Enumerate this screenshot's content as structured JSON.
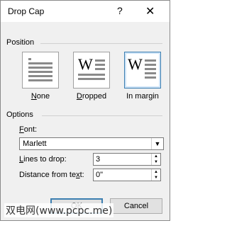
{
  "dialog": {
    "title": "Drop Cap",
    "help_glyph": "?",
    "close_glyph": "✕"
  },
  "position": {
    "section_label": "Position",
    "options": [
      {
        "label": "None",
        "access_key": "N",
        "rest": "one"
      },
      {
        "label": "Dropped",
        "access_key": "D",
        "rest": "ropped"
      },
      {
        "label": "In margin",
        "access_key": "",
        "rest": "In margin"
      }
    ],
    "selected": "In margin",
    "letter": "W"
  },
  "options": {
    "section_label": "Options",
    "font": {
      "label_key": "F",
      "label_rest": "ont:",
      "value": "Marlett"
    },
    "lines_to_drop": {
      "label_key": "L",
      "label_rest": "ines to drop:",
      "value": "3"
    },
    "distance_from_text": {
      "label_pre": "Distance from te",
      "label_key": "x",
      "label_rest": "t:",
      "value": "0\""
    }
  },
  "buttons": {
    "ok": "OK",
    "cancel": "Cancel"
  },
  "watermark": "双电网(www.pcpc.me)"
}
